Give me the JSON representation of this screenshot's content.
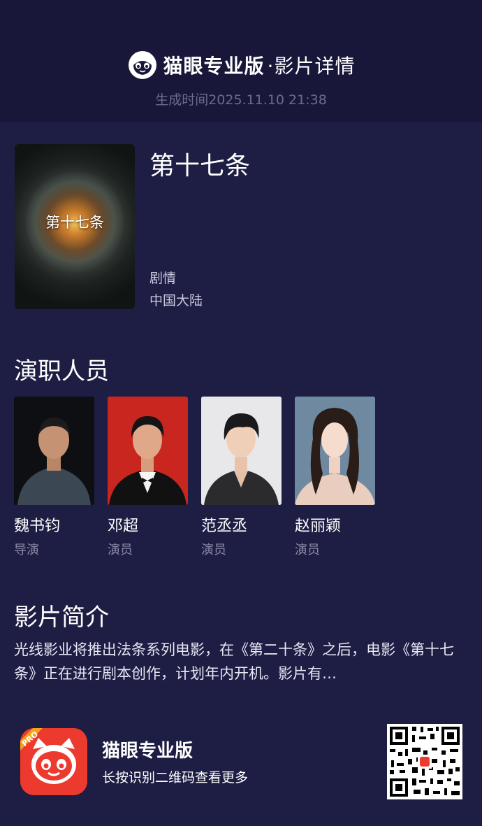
{
  "header": {
    "app_name": "猫眼专业版",
    "page_title": "·影片详情",
    "generated_time": "生成时间2025.11.10 21:38"
  },
  "movie": {
    "poster_text": "第十七条",
    "title": "第十七条",
    "genre": "剧情",
    "region": "中国大陆"
  },
  "cast": {
    "section_title": "演职人员",
    "members": [
      {
        "name": "魏书钧",
        "role": "导演"
      },
      {
        "name": "邓超",
        "role": "演员"
      },
      {
        "name": "范丞丞",
        "role": "演员"
      },
      {
        "name": "赵丽颖",
        "role": "演员"
      }
    ]
  },
  "synopsis": {
    "section_title": "影片简介",
    "text": "光线影业将推出法条系列电影，在《第二十条》之后，电影《第十七条》正在进行剧本创作，计划年内开机。影片有…"
  },
  "footer": {
    "app_badge": "PRO",
    "app_name": "猫眼专业版",
    "hint": "长按识别二维码查看更多"
  },
  "colors": {
    "background": "#1e1d44",
    "header_background": "#18173a",
    "muted_text": "#8b8aa8",
    "app_red": "#ec3a2f"
  },
  "icons": [
    "maoyan-cat-logo-icon",
    "maoyan-pro-app-icon",
    "qr-code"
  ]
}
